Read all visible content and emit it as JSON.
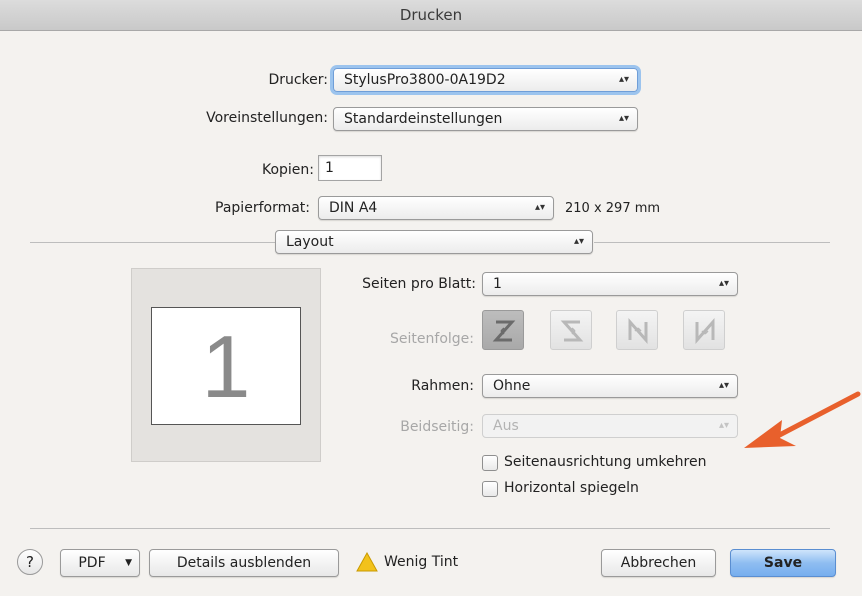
{
  "window": {
    "title": "Drucken"
  },
  "printer": {
    "label": "Drucker:",
    "value": "StylusPro3800-0A19D2"
  },
  "presets": {
    "label": "Voreinstellungen:",
    "value": "Standardeinstellungen"
  },
  "copies": {
    "label": "Kopien:",
    "value": "1"
  },
  "paper": {
    "label": "Papierformat:",
    "value": "DIN A4",
    "size": "210 x 297 mm"
  },
  "section": {
    "value": "Layout"
  },
  "preview": {
    "page_number": "1"
  },
  "layout": {
    "pages_per_sheet": {
      "label": "Seiten pro Blatt:",
      "value": "1"
    },
    "page_order": {
      "label": "Seitenfolge:",
      "icons": [
        "z-order-icon",
        "s-order-icon",
        "reverse-n-order-icon",
        "n-order-icon"
      ]
    },
    "border": {
      "label": "Rahmen:",
      "value": "Ohne"
    },
    "two_sided": {
      "label": "Beidseitig:",
      "value": "Aus"
    },
    "reverse_orientation": {
      "label": "Seitenausrichtung umkehren",
      "checked": false
    },
    "flip_horizontal": {
      "label": "Horizontal spiegeln",
      "checked": false
    }
  },
  "footer": {
    "help": "?",
    "pdf": "PDF",
    "hide_details": "Details ausblenden",
    "warning": "Wenig Tint",
    "cancel": "Abbrechen",
    "save": "Save"
  },
  "colors": {
    "accent": "#7fb3ef",
    "annotation_arrow": "#e8602c"
  }
}
